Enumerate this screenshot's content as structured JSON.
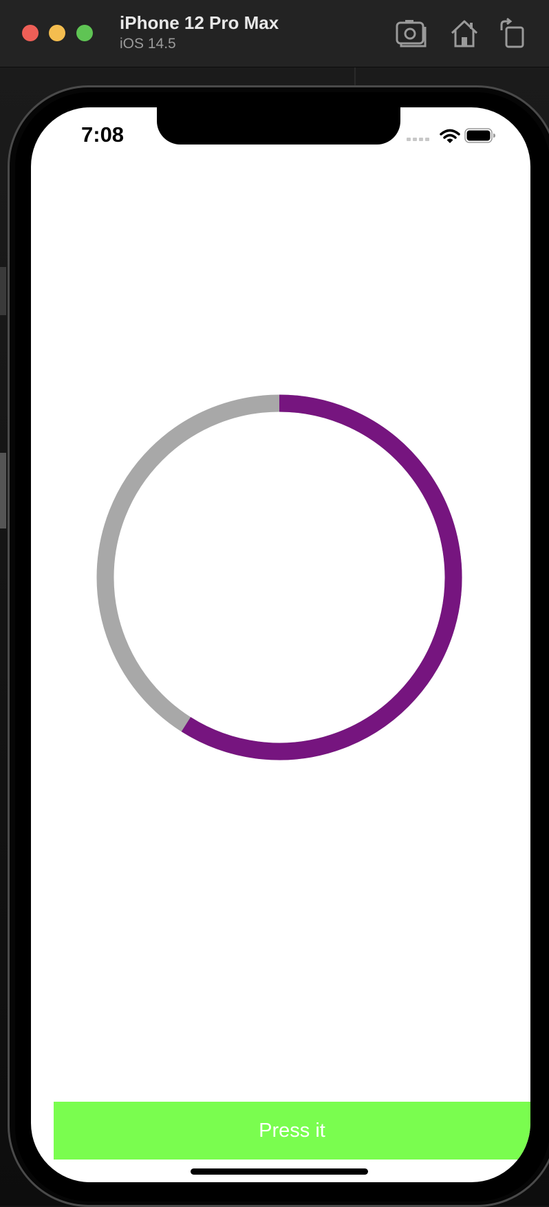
{
  "window": {
    "device_name": "iPhone 12 Pro Max",
    "os_version": "iOS 14.5",
    "toolbar": [
      {
        "icon": "screenshot-icon"
      },
      {
        "icon": "home-icon"
      },
      {
        "icon": "rotate-icon"
      }
    ]
  },
  "status_bar": {
    "time": "7:08",
    "icons": [
      "cellular-icon",
      "wifi-icon",
      "battery-icon"
    ]
  },
  "progress": {
    "value": 0.59,
    "track_color": "#a8a8a8",
    "progress_color": "#76157f"
  },
  "button": {
    "label": "Press it",
    "background": "#7afd4f",
    "text_color": "#ffffff"
  }
}
